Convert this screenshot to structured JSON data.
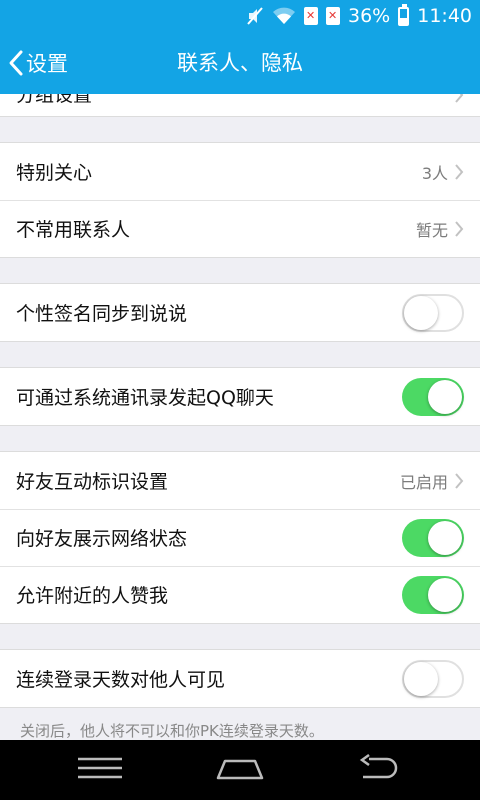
{
  "status_bar": {
    "battery_percent": "36%",
    "battery_level": 0.36,
    "time": "11:40",
    "icons": [
      "mute-icon",
      "wifi-icon",
      "sim-error-icon",
      "sim-error-icon",
      "battery-icon"
    ]
  },
  "nav": {
    "back_label": "设置",
    "title": "联系人、隐私"
  },
  "top_partial_label": "分组设置",
  "groups": [
    {
      "rows": [
        {
          "label": "特别关心",
          "value": "3人"
        },
        {
          "label": "不常用联系人",
          "value": "暂无"
        }
      ]
    },
    {
      "rows": [
        {
          "label": "个性签名同步到说说",
          "toggle": false
        }
      ]
    },
    {
      "rows": [
        {
          "label": "可通过系统通讯录发起QQ聊天",
          "toggle": true
        }
      ]
    },
    {
      "rows": [
        {
          "label": "好友互动标识设置",
          "value": "已启用"
        },
        {
          "label": "向好友展示网络状态",
          "toggle": true
        },
        {
          "label": "允许附近的人赞我",
          "toggle": true
        }
      ]
    },
    {
      "rows": [
        {
          "label": "连续登录天数对他人可见",
          "toggle": false
        }
      ]
    }
  ],
  "footnote": "关闭后，他人将不可以和你PK连续登录天数。",
  "colors": {
    "brand_blue": "#13a4e5",
    "switch_on": "#4cd964",
    "background": "#efeff4"
  }
}
